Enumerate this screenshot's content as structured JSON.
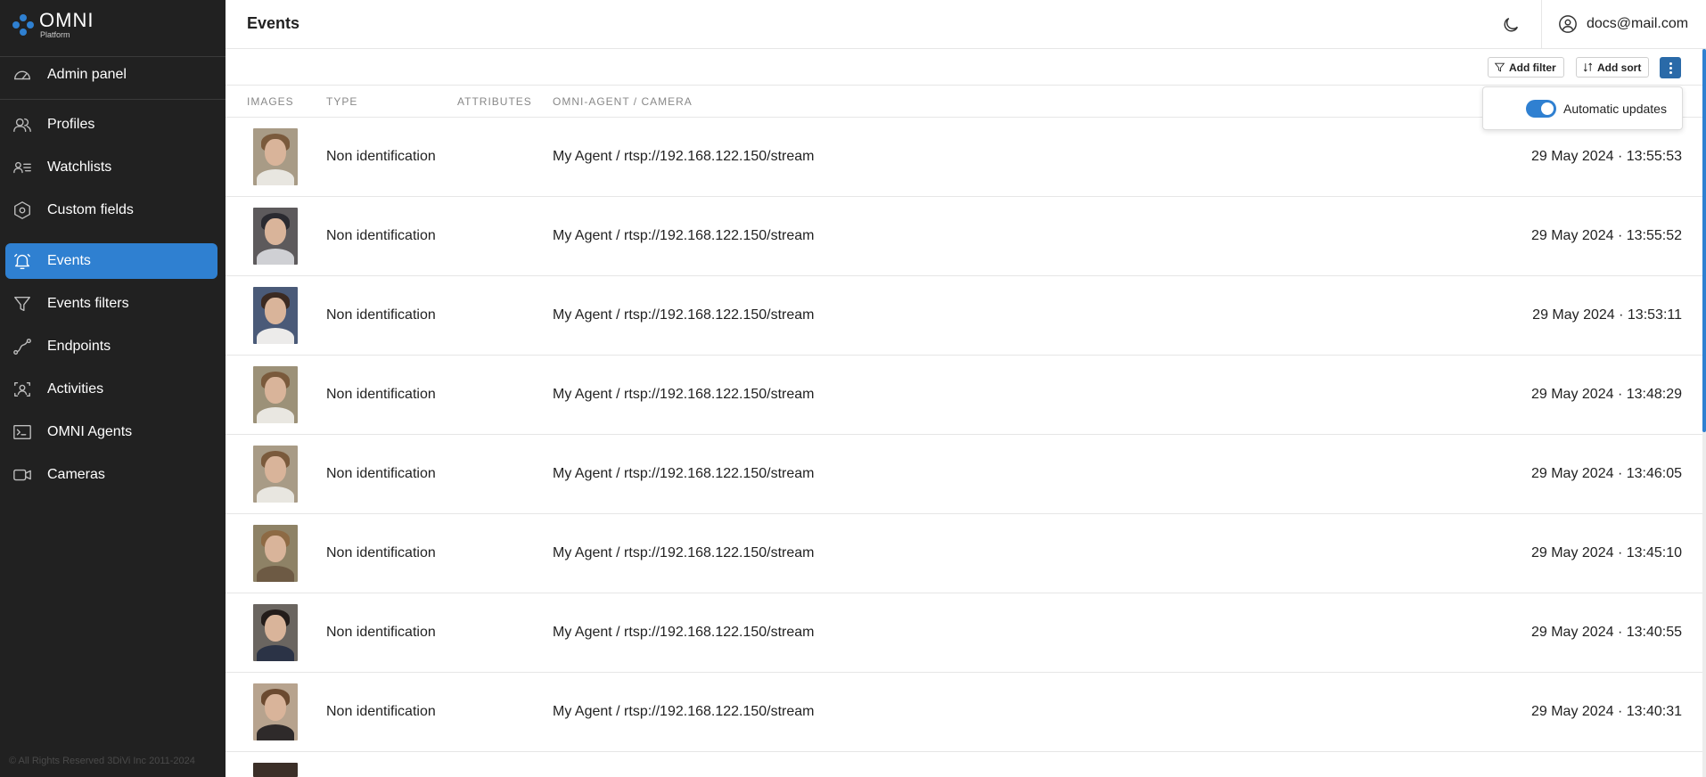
{
  "brand": {
    "name": "OMNI",
    "sub": "Platform"
  },
  "sidebar": {
    "items": [
      {
        "label": "Admin panel",
        "icon": "gauge-icon",
        "active": false
      },
      {
        "label": "Profiles",
        "icon": "users-icon",
        "active": false
      },
      {
        "label": "Watchlists",
        "icon": "user-list-icon",
        "active": false
      },
      {
        "label": "Custom fields",
        "icon": "hexagon-settings-icon",
        "active": false
      },
      {
        "label": "Events",
        "icon": "bell-icon",
        "active": true
      },
      {
        "label": "Events filters",
        "icon": "filter-icon",
        "active": false
      },
      {
        "label": "Endpoints",
        "icon": "route-icon",
        "active": false
      },
      {
        "label": "Activities",
        "icon": "scan-user-icon",
        "active": false
      },
      {
        "label": "OMNI Agents",
        "icon": "terminal-icon",
        "active": false
      },
      {
        "label": "Cameras",
        "icon": "video-camera-icon",
        "active": false
      }
    ],
    "copyright": "© All Rights Reserved 3DiVi Inc 2011-2024"
  },
  "header": {
    "title": "Events",
    "user_email": "docs@mail.com"
  },
  "toolbar": {
    "add_filter": "Add filter",
    "add_sort": "Add sort"
  },
  "popover": {
    "automatic_updates_label": "Automatic updates",
    "automatic_updates_on": true
  },
  "table": {
    "headers": [
      "IMAGES",
      "TYPE",
      "ATTRIBUTES",
      "OMNI-AGENT / CAMERA"
    ],
    "rows": [
      {
        "type": "Non identification",
        "camera": "My Agent / rtsp://192.168.122.150/stream",
        "date": "29 May 2024 · 13:55:53"
      },
      {
        "type": "Non identification",
        "camera": "My Agent / rtsp://192.168.122.150/stream",
        "date": "29 May 2024 · 13:55:52"
      },
      {
        "type": "Non identification",
        "camera": "My Agent / rtsp://192.168.122.150/stream",
        "date": "29 May 2024 · 13:53:11"
      },
      {
        "type": "Non identification",
        "camera": "My Agent / rtsp://192.168.122.150/stream",
        "date": "29 May 2024 · 13:48:29"
      },
      {
        "type": "Non identification",
        "camera": "My Agent / rtsp://192.168.122.150/stream",
        "date": "29 May 2024 · 13:46:05"
      },
      {
        "type": "Non identification",
        "camera": "My Agent / rtsp://192.168.122.150/stream",
        "date": "29 May 2024 · 13:45:10"
      },
      {
        "type": "Non identification",
        "camera": "My Agent / rtsp://192.168.122.150/stream",
        "date": "29 May 2024 · 13:40:55"
      },
      {
        "type": "Non identification",
        "camera": "My Agent / rtsp://192.168.122.150/stream",
        "date": "29 May 2024 · 13:40:31"
      }
    ]
  },
  "colors": {
    "accent": "#2f80d1",
    "sidebar_bg": "#212121",
    "more_button": "#2a6aa8"
  }
}
